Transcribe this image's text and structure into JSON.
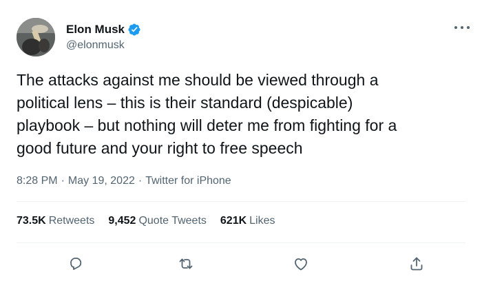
{
  "author": {
    "name": "Elon Musk",
    "handle": "@elonmusk",
    "verified_color": "#1d9bf0",
    "avatar_icon": "profile-photo"
  },
  "tweet": {
    "text": "The attacks against me should be viewed through a\npolitical lens – this is their standard (despicable)\nplaybook – but nothing will deter me from fighting for a\ngood future and your right to free speech"
  },
  "meta": {
    "time": "8:28 PM",
    "date": "May 19, 2022",
    "source": "Twitter for iPhone",
    "separator": "·"
  },
  "stats": {
    "retweets_count": "73.5K",
    "retweets_label": "Retweets",
    "quotes_count": "9,452",
    "quotes_label": "Quote Tweets",
    "likes_count": "621K",
    "likes_label": "Likes"
  },
  "actions": {
    "icons": [
      "reply-icon",
      "retweet-icon",
      "like-icon",
      "share-icon"
    ]
  },
  "colors": {
    "text": "#0f1419",
    "secondary": "#536471",
    "divider": "#eff3f4",
    "brand": "#1d9bf0"
  }
}
